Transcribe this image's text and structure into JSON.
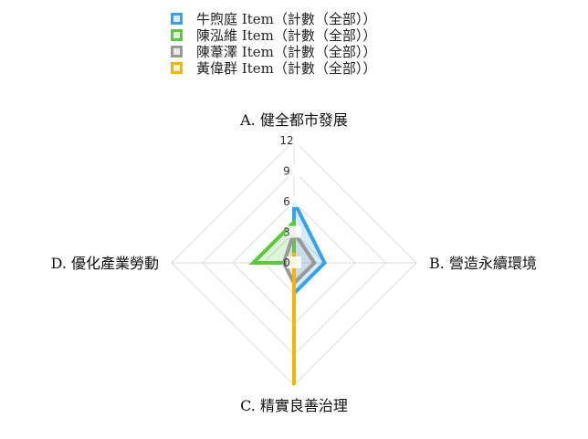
{
  "chart_data": {
    "type": "radar",
    "axes": [
      "A. 健全都市發展",
      "B. 營造永續環境",
      "C. 精實良善治理",
      "D. 優化產業勞動"
    ],
    "rlim": [
      0,
      12
    ],
    "ticks": [
      "0",
      "3",
      "6",
      "9",
      "12"
    ],
    "grid": true,
    "legend_position": "top",
    "series": [
      {
        "name": "牛煦庭 Item（計數（全部））",
        "color": "#36a2eb",
        "values": [
          6,
          3,
          3,
          0
        ]
      },
      {
        "name": "陳泓維 Item（計數（全部））",
        "color": "#5ac93a",
        "values": [
          4,
          0,
          0,
          4
        ]
      },
      {
        "name": "陳葦澤 Item（計數（全部））",
        "color": "#999999",
        "values": [
          3,
          2,
          2,
          1
        ]
      },
      {
        "name": "黃偉群 Item（計數（全部））",
        "color": "#f5b400",
        "values": [
          1,
          0,
          12,
          0
        ]
      }
    ]
  }
}
